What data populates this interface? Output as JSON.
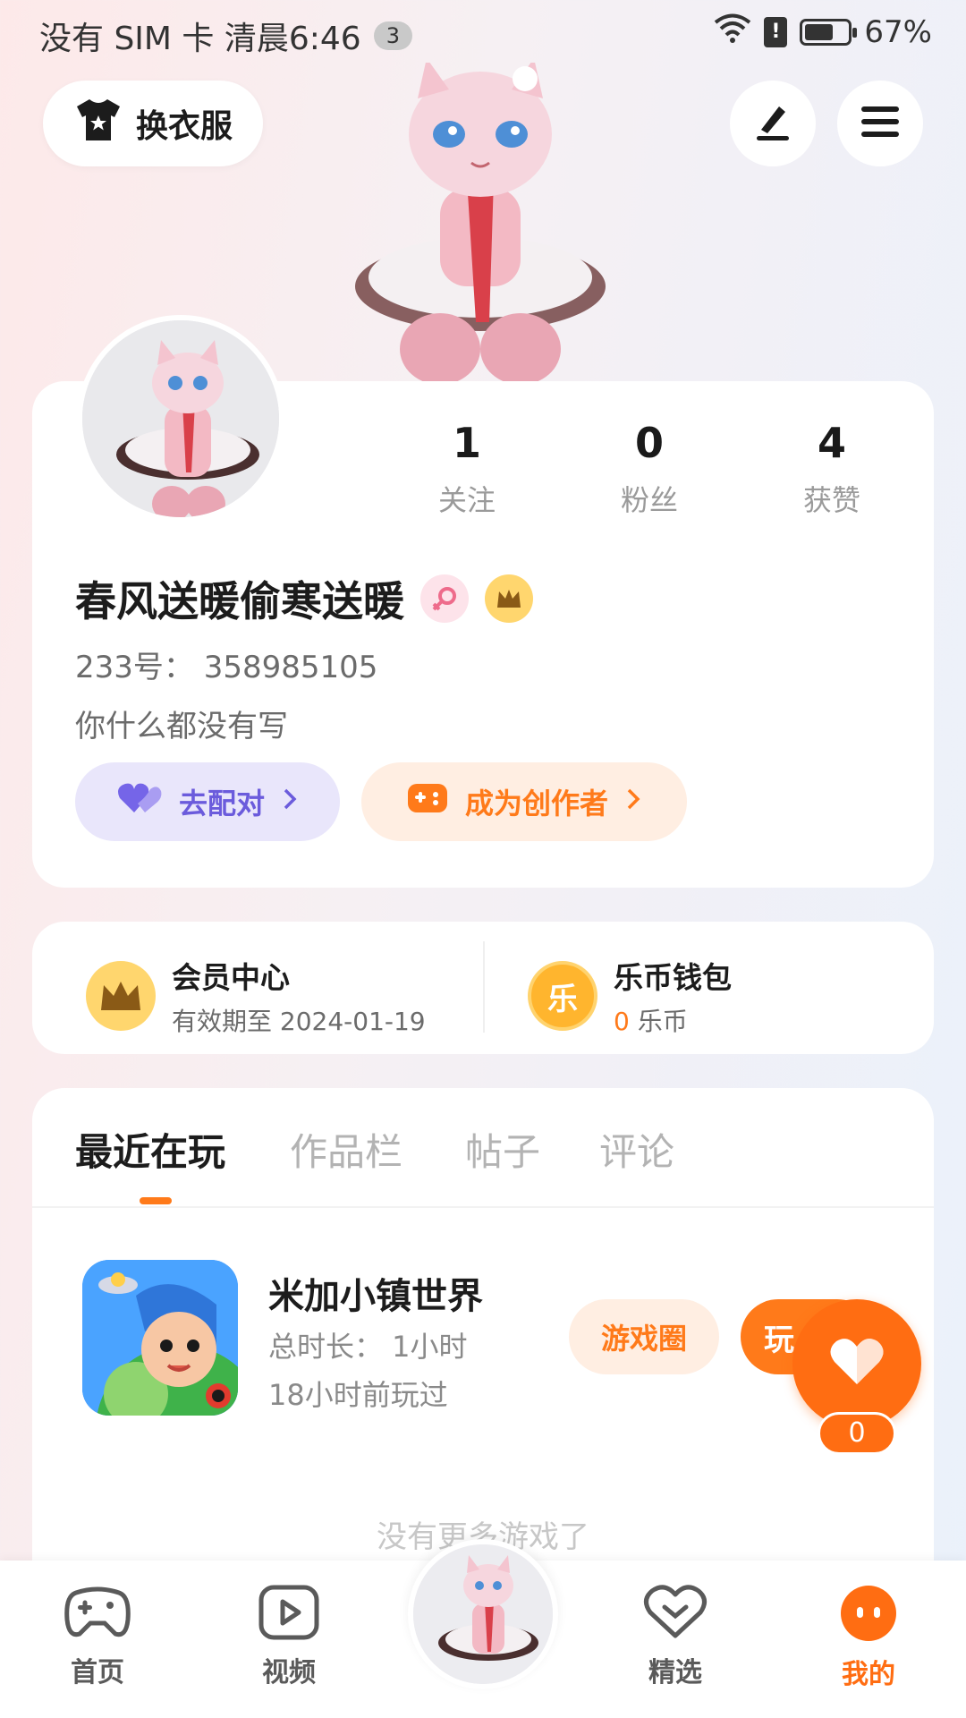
{
  "status_bar": {
    "carrier_time": "没有 SIM 卡 清晨6:46",
    "notification_count": "3",
    "battery_percent": "67%",
    "battery_level": 0.67,
    "icons": [
      "wifi-icon",
      "alert-icon",
      "battery-icon"
    ]
  },
  "header": {
    "dress_label": "换衣服",
    "dress_icon": "tshirt-icon",
    "edit_icon": "pen-icon",
    "menu_icon": "hamburger-icon"
  },
  "profile": {
    "stats": [
      {
        "value": "1",
        "label": "关注"
      },
      {
        "value": "0",
        "label": "粉丝"
      },
      {
        "value": "4",
        "label": "获赞"
      }
    ],
    "username": "春风送暖偷寒送暖",
    "badges": [
      "female-icon",
      "crown-icon"
    ],
    "id_line": "233号：  358985105",
    "bio": "你什么都没有写",
    "match_label": "去配对",
    "creator_label": "成为创作者"
  },
  "member": {
    "title": "会员中心",
    "subtitle": "有效期至 2024-01-19"
  },
  "wallet": {
    "title": "乐币钱包",
    "icon_char": "乐",
    "amount": "0",
    "unit": "乐币"
  },
  "tabs": [
    {
      "label": "最近在玩",
      "active": true
    },
    {
      "label": "作品栏",
      "active": false
    },
    {
      "label": "帖子",
      "active": false
    },
    {
      "label": "评论",
      "active": false
    }
  ],
  "recent_game": {
    "title": "米加小镇世界",
    "duration": "总时长：  1小时",
    "last_played": "18小时前玩过",
    "circle_label": "游戏圈",
    "play_label": "玩"
  },
  "fab": {
    "count": "0",
    "icon": "heart-icon"
  },
  "empty_text": "没有更多游戏了",
  "bottom_nav": [
    {
      "label": "首页",
      "icon": "gamepad-icon",
      "active": false
    },
    {
      "label": "视频",
      "icon": "video-icon",
      "active": false
    },
    {
      "label": "精选",
      "icon": "heart-badge-icon",
      "active": false
    },
    {
      "label": "我的",
      "icon": "face-icon",
      "active": true
    }
  ],
  "colors": {
    "accent": "#ff6d12",
    "match_bg": "#e9e6fb",
    "match_text": "#6b5bdc",
    "creator_bg": "#ffeee2",
    "creator_text": "#ff7a1a"
  }
}
